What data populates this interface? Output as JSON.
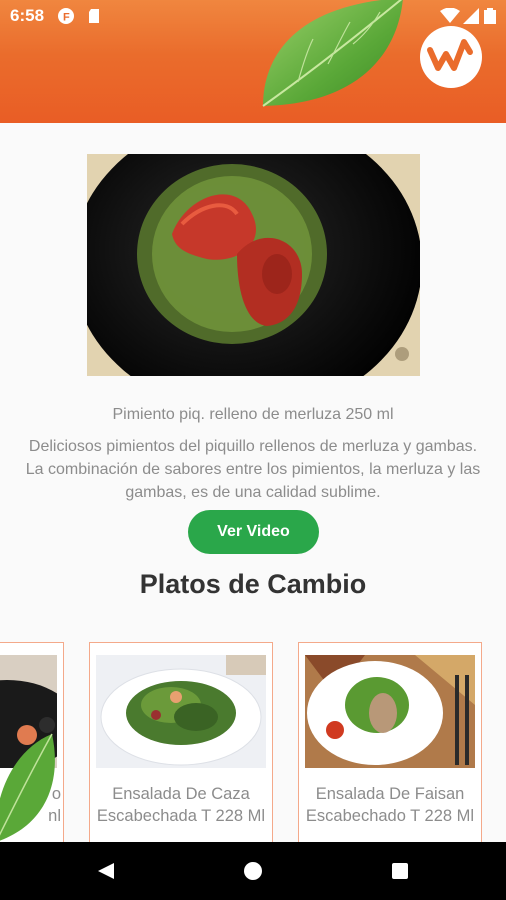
{
  "status_bar": {
    "time": "6:58"
  },
  "header": {
    "logo_icon": "w-brand-logo",
    "colors": {
      "primary": "#ea6c2c",
      "accent": "#2aa74a"
    }
  },
  "product": {
    "name": "Pimiento piq. relleno de merluza 250 ml",
    "description": "Deliciosos pimientos del piquillo rellenos de merluza y gambas. La combinación de sabores entre los pimientos, la merluza y las gambas, es de una calidad sublime.",
    "video_button_label": "Ver Video"
  },
  "section": {
    "title": "Platos de Cambio"
  },
  "cards": [
    {
      "title": "o\nnl"
    },
    {
      "title": "Ensalada De Caza Escabechada T 228 Ml"
    },
    {
      "title": "Ensalada De Faisan Escabechado T 228 Ml"
    }
  ]
}
